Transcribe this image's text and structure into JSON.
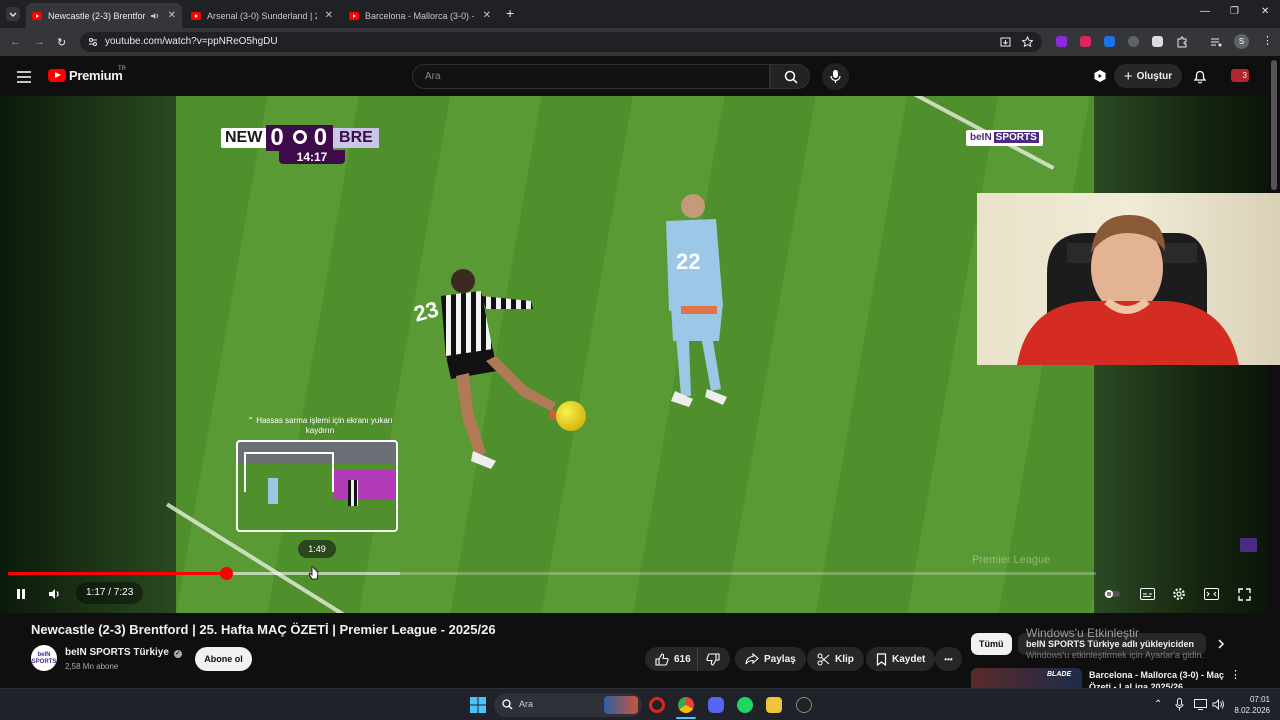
{
  "browser": {
    "tabs": [
      {
        "title": "Newcastle (2-3) Brentford |",
        "active": true,
        "audio": true
      },
      {
        "title": "Arsenal (3-0) Sunderland | 25. H",
        "active": false
      },
      {
        "title": "Barcelona - Mallorca (3-0) - Ma",
        "active": false
      }
    ],
    "new_tab": "+",
    "url": "youtube.com/watch?v=ppNReO5hgDU",
    "profile_initial": "S"
  },
  "youtube": {
    "logo": "Premium",
    "logo_region": "TR",
    "search_placeholder": "Ara",
    "create_label": "Oluştur",
    "notifications_badge": "3"
  },
  "player": {
    "scoreboard": {
      "home": "NEW",
      "home_score": "0",
      "away_score": "0",
      "away": "BRE",
      "clock": "14:17"
    },
    "broadcaster": {
      "name": "beIN",
      "suffix": "SPORTS"
    },
    "jersey_numbers": [
      "23",
      "22"
    ],
    "watermark": "Premier League",
    "scrub_hint": "⌃ Hassas sarma işlemi için ekranı yukarı kaydırın",
    "preview_time": "1:49",
    "current_time": "1:17",
    "duration": "7:23",
    "time_display": "1:17 / 7:23",
    "played_fraction": 0.2,
    "buffered_fraction": 0.36,
    "hover_fraction": 0.28
  },
  "video": {
    "title": "Newcastle (2-3) Brentford | 25. Hafta MAÇ ÖZETİ | Premier League - 2025/26",
    "channel": "beIN SPORTS Türkiye",
    "channel_avatar_text": "beIN SPORTS",
    "subscribers": "2,58 Mn abone",
    "subscribe_label": "Abone ol",
    "likes": "616",
    "share_label": "Paylaş",
    "clip_label": "Klip",
    "save_label": "Kaydet",
    "more_label": "•••"
  },
  "sidebar": {
    "filters": [
      "Tümü",
      "beIN SPORTS Türkiye adlı yükleyiciden"
    ],
    "activation_title": "Windows'u Etkinleştir",
    "activation_sub": "Windows'u etkinleştirmek için Ayarlar'a gidin.",
    "recommended": [
      {
        "title": "Barcelona - Mallorca (3-0) - Maç Özeti - LaLiga 2025/26",
        "thumb_text": "BLADE"
      }
    ]
  },
  "taskbar": {
    "search_placeholder": "Ara",
    "time": "07:01",
    "date": "8.02.2026"
  },
  "colors": {
    "youtube_red": "#ff0000",
    "pl_purple": "#3d0a4a",
    "bein_purple": "#4b2c82"
  }
}
